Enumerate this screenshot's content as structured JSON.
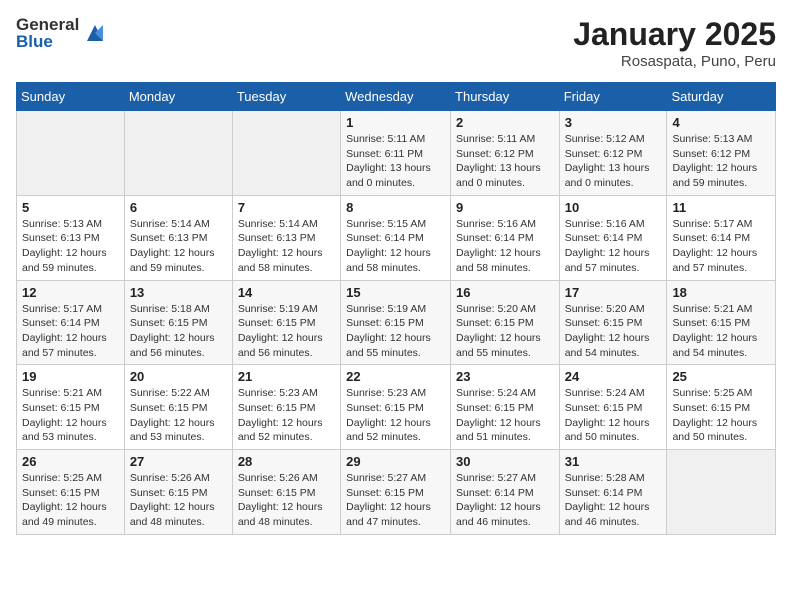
{
  "header": {
    "logo_general": "General",
    "logo_blue": "Blue",
    "month": "January 2025",
    "location": "Rosaspata, Puno, Peru"
  },
  "days_of_week": [
    "Sunday",
    "Monday",
    "Tuesday",
    "Wednesday",
    "Thursday",
    "Friday",
    "Saturday"
  ],
  "weeks": [
    [
      {
        "day": "",
        "info": ""
      },
      {
        "day": "",
        "info": ""
      },
      {
        "day": "",
        "info": ""
      },
      {
        "day": "1",
        "info": "Sunrise: 5:11 AM\nSunset: 6:11 PM\nDaylight: 13 hours and 0 minutes."
      },
      {
        "day": "2",
        "info": "Sunrise: 5:11 AM\nSunset: 6:12 PM\nDaylight: 13 hours and 0 minutes."
      },
      {
        "day": "3",
        "info": "Sunrise: 5:12 AM\nSunset: 6:12 PM\nDaylight: 13 hours and 0 minutes."
      },
      {
        "day": "4",
        "info": "Sunrise: 5:13 AM\nSunset: 6:12 PM\nDaylight: 12 hours and 59 minutes."
      }
    ],
    [
      {
        "day": "5",
        "info": "Sunrise: 5:13 AM\nSunset: 6:13 PM\nDaylight: 12 hours and 59 minutes."
      },
      {
        "day": "6",
        "info": "Sunrise: 5:14 AM\nSunset: 6:13 PM\nDaylight: 12 hours and 59 minutes."
      },
      {
        "day": "7",
        "info": "Sunrise: 5:14 AM\nSunset: 6:13 PM\nDaylight: 12 hours and 58 minutes."
      },
      {
        "day": "8",
        "info": "Sunrise: 5:15 AM\nSunset: 6:14 PM\nDaylight: 12 hours and 58 minutes."
      },
      {
        "day": "9",
        "info": "Sunrise: 5:16 AM\nSunset: 6:14 PM\nDaylight: 12 hours and 58 minutes."
      },
      {
        "day": "10",
        "info": "Sunrise: 5:16 AM\nSunset: 6:14 PM\nDaylight: 12 hours and 57 minutes."
      },
      {
        "day": "11",
        "info": "Sunrise: 5:17 AM\nSunset: 6:14 PM\nDaylight: 12 hours and 57 minutes."
      }
    ],
    [
      {
        "day": "12",
        "info": "Sunrise: 5:17 AM\nSunset: 6:14 PM\nDaylight: 12 hours and 57 minutes."
      },
      {
        "day": "13",
        "info": "Sunrise: 5:18 AM\nSunset: 6:15 PM\nDaylight: 12 hours and 56 minutes."
      },
      {
        "day": "14",
        "info": "Sunrise: 5:19 AM\nSunset: 6:15 PM\nDaylight: 12 hours and 56 minutes."
      },
      {
        "day": "15",
        "info": "Sunrise: 5:19 AM\nSunset: 6:15 PM\nDaylight: 12 hours and 55 minutes."
      },
      {
        "day": "16",
        "info": "Sunrise: 5:20 AM\nSunset: 6:15 PM\nDaylight: 12 hours and 55 minutes."
      },
      {
        "day": "17",
        "info": "Sunrise: 5:20 AM\nSunset: 6:15 PM\nDaylight: 12 hours and 54 minutes."
      },
      {
        "day": "18",
        "info": "Sunrise: 5:21 AM\nSunset: 6:15 PM\nDaylight: 12 hours and 54 minutes."
      }
    ],
    [
      {
        "day": "19",
        "info": "Sunrise: 5:21 AM\nSunset: 6:15 PM\nDaylight: 12 hours and 53 minutes."
      },
      {
        "day": "20",
        "info": "Sunrise: 5:22 AM\nSunset: 6:15 PM\nDaylight: 12 hours and 53 minutes."
      },
      {
        "day": "21",
        "info": "Sunrise: 5:23 AM\nSunset: 6:15 PM\nDaylight: 12 hours and 52 minutes."
      },
      {
        "day": "22",
        "info": "Sunrise: 5:23 AM\nSunset: 6:15 PM\nDaylight: 12 hours and 52 minutes."
      },
      {
        "day": "23",
        "info": "Sunrise: 5:24 AM\nSunset: 6:15 PM\nDaylight: 12 hours and 51 minutes."
      },
      {
        "day": "24",
        "info": "Sunrise: 5:24 AM\nSunset: 6:15 PM\nDaylight: 12 hours and 50 minutes."
      },
      {
        "day": "25",
        "info": "Sunrise: 5:25 AM\nSunset: 6:15 PM\nDaylight: 12 hours and 50 minutes."
      }
    ],
    [
      {
        "day": "26",
        "info": "Sunrise: 5:25 AM\nSunset: 6:15 PM\nDaylight: 12 hours and 49 minutes."
      },
      {
        "day": "27",
        "info": "Sunrise: 5:26 AM\nSunset: 6:15 PM\nDaylight: 12 hours and 48 minutes."
      },
      {
        "day": "28",
        "info": "Sunrise: 5:26 AM\nSunset: 6:15 PM\nDaylight: 12 hours and 48 minutes."
      },
      {
        "day": "29",
        "info": "Sunrise: 5:27 AM\nSunset: 6:15 PM\nDaylight: 12 hours and 47 minutes."
      },
      {
        "day": "30",
        "info": "Sunrise: 5:27 AM\nSunset: 6:14 PM\nDaylight: 12 hours and 46 minutes."
      },
      {
        "day": "31",
        "info": "Sunrise: 5:28 AM\nSunset: 6:14 PM\nDaylight: 12 hours and 46 minutes."
      },
      {
        "day": "",
        "info": ""
      }
    ]
  ]
}
